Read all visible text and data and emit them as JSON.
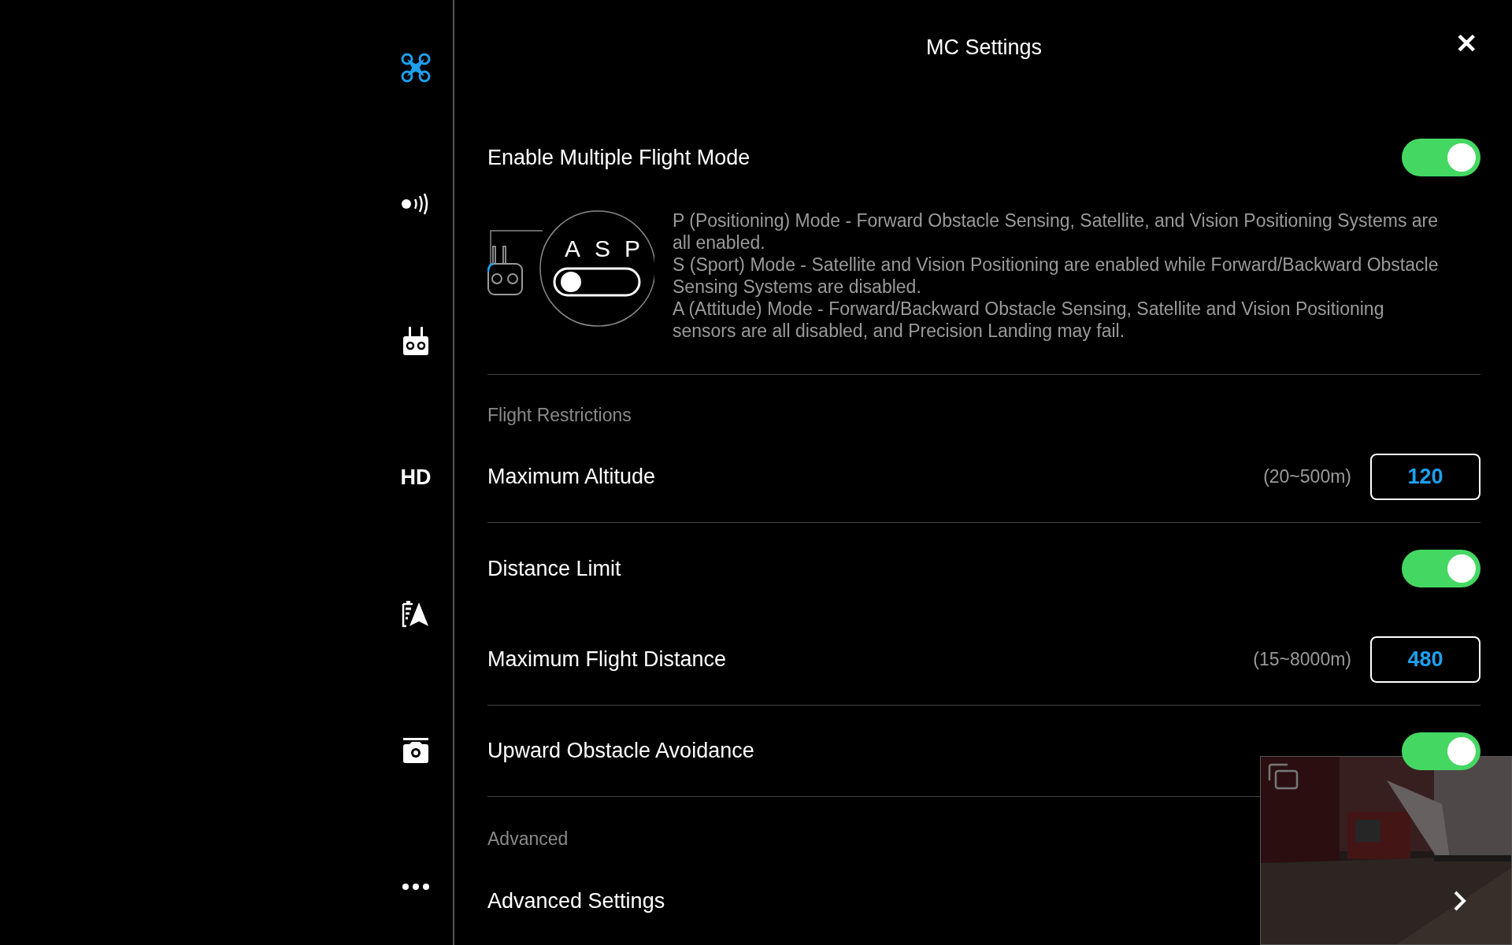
{
  "sidebar": {
    "items": [
      {
        "kind": "aircraft",
        "selected": true
      },
      {
        "kind": "signal",
        "selected": false
      },
      {
        "kind": "remote",
        "selected": false
      },
      {
        "kind": "text",
        "label": "HD",
        "selected": false
      },
      {
        "kind": "battery",
        "selected": false
      },
      {
        "kind": "camera",
        "selected": false
      },
      {
        "kind": "more",
        "selected": false
      }
    ]
  },
  "header": {
    "title": "MC Settings",
    "close": "✕"
  },
  "rows": [
    {
      "kind": "toggle",
      "label": "Enable Multiple Flight Mode",
      "on": true,
      "divider": false
    },
    {
      "kind": "mode_info",
      "switch_letters": [
        "A",
        "S",
        "P"
      ],
      "lines": [
        "P (Positioning) Mode - Forward Obstacle Sensing, Satellite, and Vision Positioning Systems are all enabled.",
        "S (Sport) Mode - Satellite and Vision Positioning are enabled while Forward/Backward Obstacle Sensing Systems are disabled.",
        "A (Attitude) Mode - Forward/Backward Obstacle Sensing, Satellite and Vision Positioning sensors are all disabled, and Precision Landing may fail."
      ],
      "divider": true
    },
    {
      "kind": "section",
      "label": "Flight Restrictions",
      "divider": false
    },
    {
      "kind": "number",
      "label": "Maximum Altitude",
      "range": "(20~500m)",
      "value": "120",
      "divider": true
    },
    {
      "kind": "toggle",
      "label": "Distance Limit",
      "on": true,
      "divider": false
    },
    {
      "kind": "number",
      "label": "Maximum Flight Distance",
      "range": "(15~8000m)",
      "value": "480",
      "divider": true
    },
    {
      "kind": "toggle",
      "label": "Upward Obstacle Avoidance",
      "on": true,
      "divider": true
    },
    {
      "kind": "section",
      "label": "Advanced",
      "divider": false
    },
    {
      "kind": "link",
      "label": "Advanced Settings",
      "divider": false
    }
  ]
}
